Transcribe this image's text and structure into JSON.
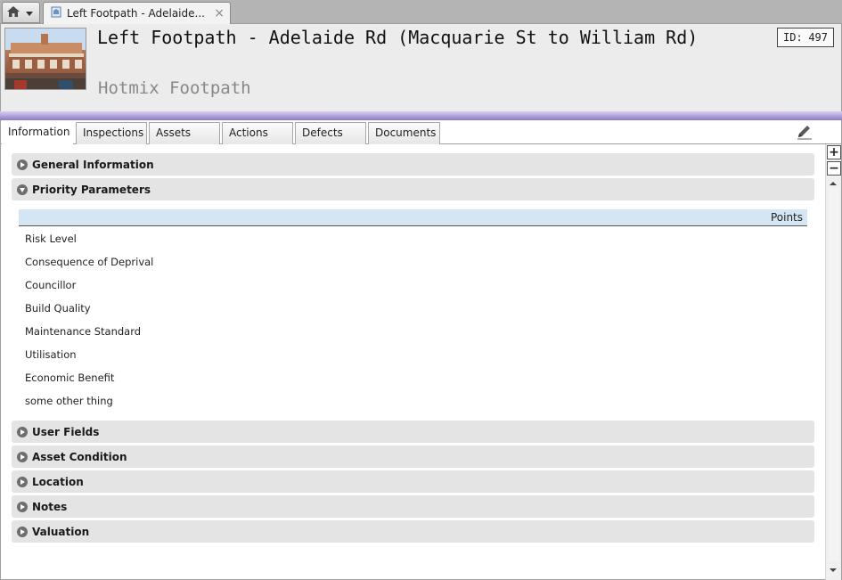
{
  "tab_strip": {
    "document_tab_title": "Left Footpath - Adelaide...",
    "close_glyph": "×"
  },
  "header": {
    "title": "Left Footpath - Adelaide Rd (Macquarie St to William Rd)",
    "subtitle": "Hotmix Footpath",
    "id_label": "ID:",
    "id_value": "497"
  },
  "inner_tabs": [
    {
      "label": "Information",
      "active": true
    },
    {
      "label": "Inspections",
      "active": false
    },
    {
      "label": "Assets",
      "active": false
    },
    {
      "label": "Actions",
      "active": false
    },
    {
      "label": "Defects",
      "active": false
    },
    {
      "label": "Documents",
      "active": false
    }
  ],
  "sections": {
    "general_information": "General Information",
    "priority_parameters": "Priority Parameters",
    "user_fields": "User Fields",
    "asset_condition": "Asset Condition",
    "location": "Location",
    "notes": "Notes",
    "valuation": "Valuation"
  },
  "priority_grid": {
    "points_header": "Points",
    "rows": [
      "Risk Level",
      "Consequence of Deprival",
      "Councillor",
      "Build Quality",
      "Maintenance Standard",
      "Utilisation",
      "Economic Benefit",
      "some other thing"
    ]
  },
  "zoom": {
    "in_glyph": "+",
    "out_glyph": "−"
  },
  "colors": {
    "accent_bar": "#8d78c4",
    "grid_header": "#d4e6f4",
    "section_bg": "#e4e4e4"
  },
  "icons": [
    "home-icon",
    "dropdown-arrow-icon",
    "page-icon",
    "close-icon",
    "pencil-icon",
    "expand-icon",
    "collapse-icon"
  ]
}
